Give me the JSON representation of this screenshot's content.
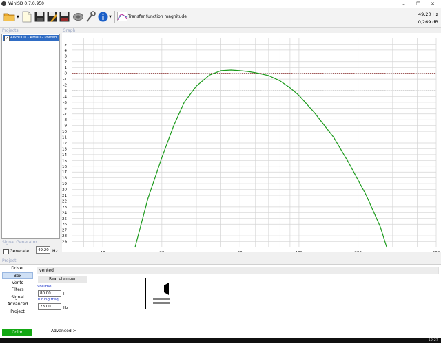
{
  "window": {
    "title": "WinISD 0.7.0.950"
  },
  "toolbar": {
    "view_label": "Transfer function magnitude",
    "readout_freq": "49,20 Hz",
    "readout_db": "0,269 dB",
    "icons": [
      "open-folder-icon",
      "dropdown-arrow-icon",
      "new-project-icon",
      "save-icon",
      "save-as-icon",
      "save-all-icon",
      "driver-editor-icon",
      "tools-icon",
      "info-icon",
      "dropdown-arrow-icon",
      "graph-icon"
    ]
  },
  "sidebar": {
    "projects_label": "Projects",
    "project_item": "AW3000 - AM80 - Ported",
    "project_checked": true,
    "signal_generator_label": "Signal Generator",
    "generate_label": "Generate",
    "generate_checked": false,
    "generator_freq": "49,20",
    "generator_unit": "Hz"
  },
  "graph": {
    "label": "Graph",
    "curve_color": "#1a9a1a",
    "ref_line_color": "#8b2a2a"
  },
  "chart_data": {
    "type": "line",
    "x_scale": "log",
    "xlim": [
      7,
      500
    ],
    "ylim": [
      -30,
      6
    ],
    "x_ticks": [
      10,
      20,
      50,
      100,
      200,
      500
    ],
    "y_ticks": [
      5,
      4,
      3,
      2,
      1,
      0,
      -1,
      -2,
      -3,
      -4,
      -5,
      -6,
      -7,
      -8,
      -9,
      -10,
      -11,
      -12,
      -13,
      -14,
      -15,
      -16,
      -17,
      -18,
      -19,
      -20,
      -21,
      -22,
      -23,
      -24,
      -25,
      -26,
      -27,
      -28,
      -29
    ],
    "reference_lines": [
      0,
      -3
    ],
    "grid": true,
    "series": [
      {
        "x": [
          14.6,
          17,
          20,
          23,
          26,
          30,
          35,
          40,
          45,
          50,
          55,
          60,
          70,
          80,
          90,
          100,
          120,
          150,
          180,
          220,
          260,
          280
        ],
        "y": [
          -30,
          -21.5,
          -14.5,
          -9,
          -5,
          -2.2,
          -0.3,
          0.45,
          0.55,
          0.45,
          0.3,
          0.1,
          -0.4,
          -1.3,
          -2.5,
          -3.8,
          -6.8,
          -11,
          -15.5,
          -21,
          -26.5,
          -30
        ]
      }
    ]
  },
  "project_panel": {
    "label": "Project",
    "nav": [
      "Driver",
      "Box",
      "Vents",
      "Filters",
      "Signal",
      "Advanced",
      "Project"
    ],
    "active_nav": "Box",
    "color_button": "Color",
    "box_type": "vented",
    "rear_chamber": "Rear chamber",
    "volume_label": "Volume",
    "volume_value": "80,00",
    "volume_unit": "l",
    "tuning_label": "Tuning freq.",
    "tuning_value": "23,00",
    "tuning_unit": "Hz",
    "advanced_link": "Advanced->"
  },
  "taskbar": {
    "time": "19:27"
  }
}
